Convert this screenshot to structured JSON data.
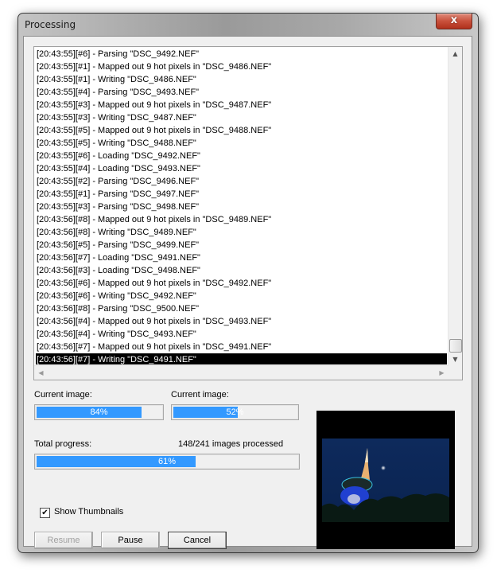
{
  "window": {
    "title": "Processing",
    "close_icon": "close-x-icon",
    "close_glyph": "x"
  },
  "log": {
    "lines": [
      "[20:43:55][#6] - Parsing \"DSC_9492.NEF\"",
      "[20:43:55][#1] - Mapped out 9 hot pixels in \"DSC_9486.NEF\"",
      "[20:43:55][#1] - Writing \"DSC_9486.NEF\"",
      "[20:43:55][#4] - Parsing \"DSC_9493.NEF\"",
      "[20:43:55][#3] - Mapped out 9 hot pixels in \"DSC_9487.NEF\"",
      "[20:43:55][#3] - Writing \"DSC_9487.NEF\"",
      "[20:43:55][#5] - Mapped out 9 hot pixels in \"DSC_9488.NEF\"",
      "[20:43:55][#5] - Writing \"DSC_9488.NEF\"",
      "[20:43:55][#6] - Loading \"DSC_9492.NEF\"",
      "[20:43:55][#4] - Loading \"DSC_9493.NEF\"",
      "[20:43:55][#2] - Parsing \"DSC_9496.NEF\"",
      "[20:43:55][#1] - Parsing \"DSC_9497.NEF\"",
      "[20:43:55][#3] - Parsing \"DSC_9498.NEF\"",
      "[20:43:56][#8] - Mapped out 9 hot pixels in \"DSC_9489.NEF\"",
      "[20:43:56][#8] - Writing \"DSC_9489.NEF\"",
      "[20:43:56][#5] - Parsing \"DSC_9499.NEF\"",
      "[20:43:56][#7] - Loading \"DSC_9491.NEF\"",
      "[20:43:56][#3] - Loading \"DSC_9498.NEF\"",
      "[20:43:56][#6] - Mapped out 9 hot pixels in \"DSC_9492.NEF\"",
      "[20:43:56][#6] - Writing \"DSC_9492.NEF\"",
      "[20:43:56][#8] - Parsing \"DSC_9500.NEF\"",
      "[20:43:56][#4] - Mapped out 9 hot pixels in \"DSC_9493.NEF\"",
      "[20:43:56][#4] - Writing \"DSC_9493.NEF\"",
      "[20:43:56][#7] - Mapped out 9 hot pixels in \"DSC_9491.NEF\"",
      "[20:43:56][#7] - Writing \"DSC_9491.NEF\""
    ],
    "selected_index": 24,
    "scroll_position": 1.0
  },
  "progress": {
    "current_image_1": {
      "label": "Current image:",
      "value": 84,
      "text": "84%"
    },
    "current_image_2": {
      "label": "Current image:",
      "value": 52,
      "text": "52%"
    },
    "total": {
      "label": "Total progress:",
      "value": 61,
      "text": "61%",
      "status": "148/241 images processed"
    },
    "fill_color": "#3399ff"
  },
  "options": {
    "show_thumbnails": {
      "label": "Show Thumbnails",
      "checked": true
    }
  },
  "buttons": {
    "resume": {
      "label": "Resume",
      "enabled": false
    },
    "pause": {
      "label": "Pause",
      "enabled": true
    },
    "cancel": {
      "label": "Cancel",
      "enabled": true,
      "default": true
    }
  },
  "thumbnail": {
    "description": "Night photo of a lit broadcast tower with moon against dark blue sky"
  }
}
